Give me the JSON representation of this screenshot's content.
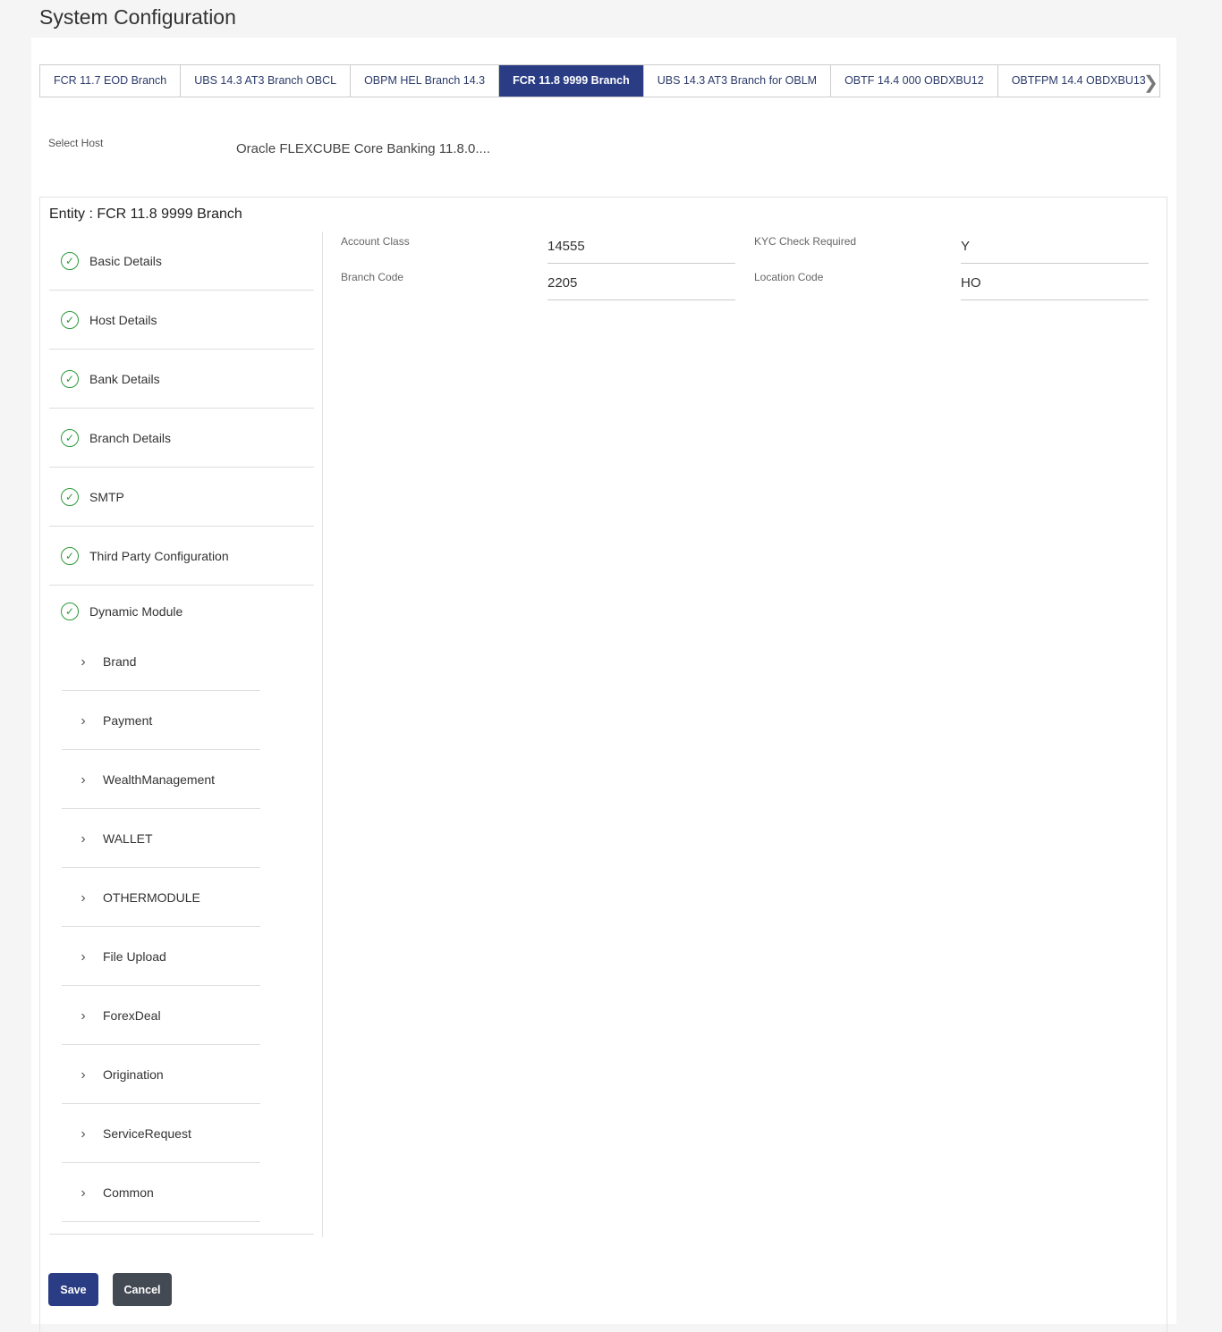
{
  "page_title": "System Configuration",
  "tabs": [
    {
      "label": "FCR 11.7 EOD Branch",
      "active": false
    },
    {
      "label": "UBS 14.3 AT3 Branch OBCL",
      "active": false
    },
    {
      "label": "OBPM HEL Branch 14.3",
      "active": false
    },
    {
      "label": "FCR 11.8 9999 Branch",
      "active": true
    },
    {
      "label": "UBS 14.3 AT3 Branch for OBLM",
      "active": false
    },
    {
      "label": "OBTF 14.4 000 OBDXBU12",
      "active": false
    },
    {
      "label": "OBTFPM 14.4 OBDXBU13",
      "active": false
    }
  ],
  "host": {
    "label": "Select Host",
    "value": "Oracle FLEXCUBE Core Banking 11.8.0...."
  },
  "entity_title": "Entity : FCR 11.8 9999 Branch",
  "nav": [
    "Basic Details",
    "Host Details",
    "Bank Details",
    "Branch Details",
    "SMTP",
    "Third Party Configuration",
    "Dynamic Module"
  ],
  "sub_nav": [
    "Brand",
    "Payment",
    "WealthManagement",
    "WALLET",
    "OTHERMODULE",
    "File Upload",
    "ForexDeal",
    "Origination",
    "ServiceRequest",
    "Common"
  ],
  "fields": {
    "account_class": {
      "label": "Account Class",
      "value": "14555"
    },
    "kyc": {
      "label": "KYC Check Required",
      "value": "Y"
    },
    "branch_code": {
      "label": "Branch Code",
      "value": "2205"
    },
    "location_code": {
      "label": "Location Code",
      "value": "HO"
    }
  },
  "buttons": {
    "save": "Save",
    "cancel": "Cancel"
  },
  "colors": {
    "primary": "#2a3d84",
    "success": "#2e9a3a",
    "secondary": "#444a54"
  }
}
